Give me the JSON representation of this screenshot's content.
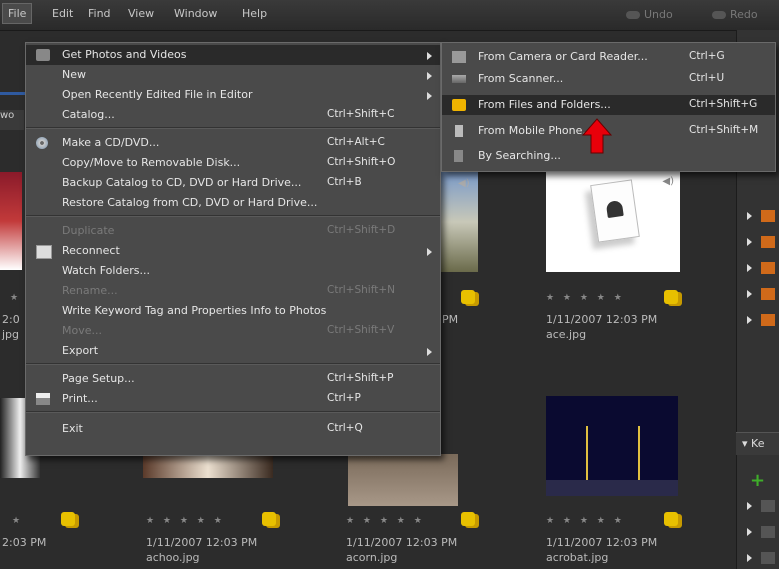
{
  "menubar": {
    "items": [
      "File",
      "Edit",
      "Find",
      "View",
      "Window",
      "Help"
    ],
    "undo": "Undo",
    "redo": "Redo"
  },
  "background": {
    "left_tab": "wo",
    "captions": [
      {
        "date": "2:0",
        "file": "jpg"
      },
      {
        "date": "PM",
        "file": ""
      },
      {
        "date": "1/11/2007 12:03 PM",
        "file": "ace.jpg"
      },
      {
        "date": "2:03 PM",
        "file": ""
      },
      {
        "date": "1/11/2007 12:03 PM",
        "file": "achoo.jpg"
      },
      {
        "date": "1/11/2007 12:03 PM",
        "file": "acorn.jpg"
      },
      {
        "date": "1/11/2007 12:03 PM",
        "file": "acrobat.jpg"
      }
    ],
    "stars": "★ ★ ★ ★ ★",
    "right_panel_label": "Ke"
  },
  "file_menu": {
    "items": [
      {
        "label": "Get Photos and Videos",
        "shortcut": "",
        "submenu": true,
        "disabled": false,
        "icon": "camera-icon"
      },
      {
        "label": "New",
        "shortcut": "",
        "submenu": true,
        "disabled": false
      },
      {
        "label": "Open Recently Edited File in Editor",
        "shortcut": "",
        "submenu": true,
        "disabled": false
      },
      {
        "label": "Catalog...",
        "shortcut": "Ctrl+Shift+C",
        "submenu": false,
        "disabled": false
      },
      {
        "label": "Make a CD/DVD...",
        "shortcut": "Ctrl+Alt+C",
        "submenu": false,
        "disabled": false,
        "icon": "disc-icon"
      },
      {
        "label": "Copy/Move to Removable Disk...",
        "shortcut": "Ctrl+Shift+O",
        "submenu": false,
        "disabled": false
      },
      {
        "label": "Backup Catalog to CD, DVD or Hard Drive...",
        "shortcut": "Ctrl+B",
        "submenu": false,
        "disabled": false
      },
      {
        "label": "Restore Catalog from CD, DVD or Hard Drive...",
        "shortcut": "",
        "submenu": false,
        "disabled": false
      },
      {
        "label": "Duplicate",
        "shortcut": "Ctrl+Shift+D",
        "submenu": false,
        "disabled": true
      },
      {
        "label": "Reconnect",
        "shortcut": "",
        "submenu": true,
        "disabled": false,
        "icon": "reconnect-icon"
      },
      {
        "label": "Watch Folders...",
        "shortcut": "",
        "submenu": false,
        "disabled": false
      },
      {
        "label": "Rename...",
        "shortcut": "Ctrl+Shift+N",
        "submenu": false,
        "disabled": true
      },
      {
        "label": "Write Keyword Tag and Properties Info to Photos",
        "shortcut": "",
        "submenu": false,
        "disabled": false
      },
      {
        "label": "Move...",
        "shortcut": "Ctrl+Shift+V",
        "submenu": false,
        "disabled": true
      },
      {
        "label": "Export",
        "shortcut": "",
        "submenu": true,
        "disabled": false
      },
      {
        "label": "Page Setup...",
        "shortcut": "Ctrl+Shift+P",
        "submenu": false,
        "disabled": false
      },
      {
        "label": "Print...",
        "shortcut": "Ctrl+P",
        "submenu": false,
        "disabled": false,
        "icon": "printer-icon"
      },
      {
        "label": "Exit",
        "shortcut": "Ctrl+Q",
        "submenu": false,
        "disabled": false
      }
    ]
  },
  "sub_menu": {
    "items": [
      {
        "label": "From Camera or Card Reader...",
        "shortcut": "Ctrl+G",
        "icon": "camera-icon"
      },
      {
        "label": "From Scanner...",
        "shortcut": "Ctrl+U",
        "icon": "scanner-icon"
      },
      {
        "label": "From Files and Folders...",
        "shortcut": "Ctrl+Shift+G",
        "icon": "folder-icon"
      },
      {
        "label": "From Mobile Phone...",
        "shortcut": "Ctrl+Shift+M",
        "icon": "phone-icon"
      },
      {
        "label": "By Searching...",
        "shortcut": "",
        "icon": "search-icon"
      }
    ]
  },
  "colors": {
    "highlight": "#2a2a2a",
    "menu_bg": "#4a4a4a",
    "arrow": "#e8000a",
    "folder": "#f0b400"
  }
}
